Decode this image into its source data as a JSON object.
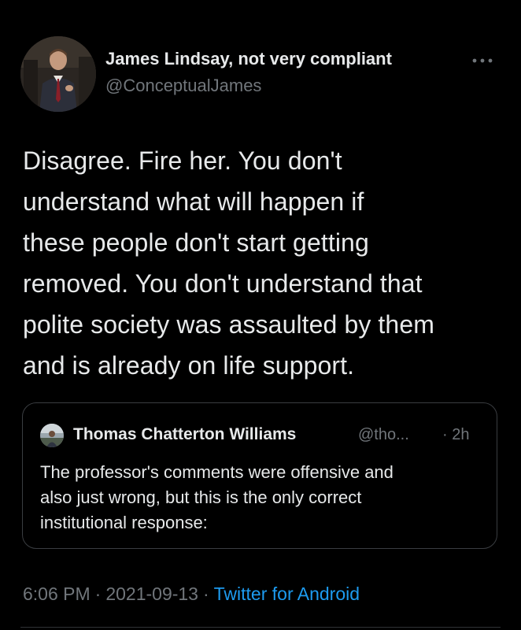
{
  "colors": {
    "background": "#000000",
    "text_primary": "#e7e9ea",
    "text_secondary": "#71767b",
    "link": "#1d9bf0",
    "border": "#3a3d41"
  },
  "tweet": {
    "author": {
      "name": "James Lindsay, not very compliant",
      "handle": "@ConceptualJames",
      "avatar_icon": "profile-photo"
    },
    "more_icon": "ellipsis-icon",
    "text_lines": [
      "Disagree. Fire her. You don't",
      "understand what will happen if",
      "these people don't start getting",
      "removed. You don't understand that",
      "polite society was assaulted by them",
      "and is already on life support."
    ],
    "quoted": {
      "name": "Thomas Chatterton Williams",
      "handle": "@tho...",
      "time": "· 2h",
      "text_lines": [
        "The professor's comments were offensive and",
        "also just wrong, but this is the only correct",
        "institutional response:"
      ]
    },
    "meta": {
      "time": "6:06 PM",
      "separator": "·",
      "date": "2021-09-13",
      "source": "Twitter for Android"
    }
  }
}
